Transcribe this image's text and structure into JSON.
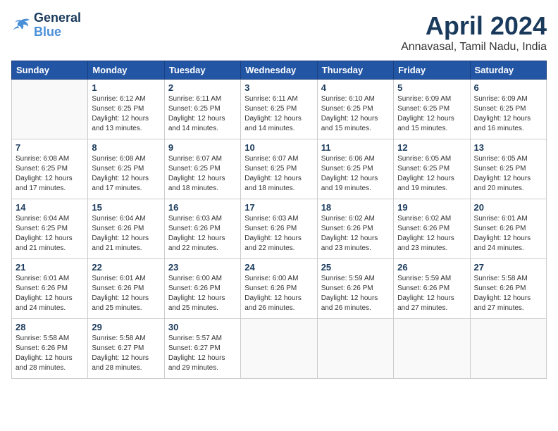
{
  "header": {
    "logo_line1": "General",
    "logo_line2": "Blue",
    "month_title": "April 2024",
    "subtitle": "Annavasal, Tamil Nadu, India"
  },
  "weekdays": [
    "Sunday",
    "Monday",
    "Tuesday",
    "Wednesday",
    "Thursday",
    "Friday",
    "Saturday"
  ],
  "weeks": [
    [
      {
        "day": null,
        "info": null
      },
      {
        "day": "1",
        "info": "Sunrise: 6:12 AM\nSunset: 6:25 PM\nDaylight: 12 hours\nand 13 minutes."
      },
      {
        "day": "2",
        "info": "Sunrise: 6:11 AM\nSunset: 6:25 PM\nDaylight: 12 hours\nand 14 minutes."
      },
      {
        "day": "3",
        "info": "Sunrise: 6:11 AM\nSunset: 6:25 PM\nDaylight: 12 hours\nand 14 minutes."
      },
      {
        "day": "4",
        "info": "Sunrise: 6:10 AM\nSunset: 6:25 PM\nDaylight: 12 hours\nand 15 minutes."
      },
      {
        "day": "5",
        "info": "Sunrise: 6:09 AM\nSunset: 6:25 PM\nDaylight: 12 hours\nand 15 minutes."
      },
      {
        "day": "6",
        "info": "Sunrise: 6:09 AM\nSunset: 6:25 PM\nDaylight: 12 hours\nand 16 minutes."
      }
    ],
    [
      {
        "day": "7",
        "info": "Sunrise: 6:08 AM\nSunset: 6:25 PM\nDaylight: 12 hours\nand 17 minutes."
      },
      {
        "day": "8",
        "info": "Sunrise: 6:08 AM\nSunset: 6:25 PM\nDaylight: 12 hours\nand 17 minutes."
      },
      {
        "day": "9",
        "info": "Sunrise: 6:07 AM\nSunset: 6:25 PM\nDaylight: 12 hours\nand 18 minutes."
      },
      {
        "day": "10",
        "info": "Sunrise: 6:07 AM\nSunset: 6:25 PM\nDaylight: 12 hours\nand 18 minutes."
      },
      {
        "day": "11",
        "info": "Sunrise: 6:06 AM\nSunset: 6:25 PM\nDaylight: 12 hours\nand 19 minutes."
      },
      {
        "day": "12",
        "info": "Sunrise: 6:05 AM\nSunset: 6:25 PM\nDaylight: 12 hours\nand 19 minutes."
      },
      {
        "day": "13",
        "info": "Sunrise: 6:05 AM\nSunset: 6:25 PM\nDaylight: 12 hours\nand 20 minutes."
      }
    ],
    [
      {
        "day": "14",
        "info": "Sunrise: 6:04 AM\nSunset: 6:25 PM\nDaylight: 12 hours\nand 21 minutes."
      },
      {
        "day": "15",
        "info": "Sunrise: 6:04 AM\nSunset: 6:26 PM\nDaylight: 12 hours\nand 21 minutes."
      },
      {
        "day": "16",
        "info": "Sunrise: 6:03 AM\nSunset: 6:26 PM\nDaylight: 12 hours\nand 22 minutes."
      },
      {
        "day": "17",
        "info": "Sunrise: 6:03 AM\nSunset: 6:26 PM\nDaylight: 12 hours\nand 22 minutes."
      },
      {
        "day": "18",
        "info": "Sunrise: 6:02 AM\nSunset: 6:26 PM\nDaylight: 12 hours\nand 23 minutes."
      },
      {
        "day": "19",
        "info": "Sunrise: 6:02 AM\nSunset: 6:26 PM\nDaylight: 12 hours\nand 23 minutes."
      },
      {
        "day": "20",
        "info": "Sunrise: 6:01 AM\nSunset: 6:26 PM\nDaylight: 12 hours\nand 24 minutes."
      }
    ],
    [
      {
        "day": "21",
        "info": "Sunrise: 6:01 AM\nSunset: 6:26 PM\nDaylight: 12 hours\nand 24 minutes."
      },
      {
        "day": "22",
        "info": "Sunrise: 6:01 AM\nSunset: 6:26 PM\nDaylight: 12 hours\nand 25 minutes."
      },
      {
        "day": "23",
        "info": "Sunrise: 6:00 AM\nSunset: 6:26 PM\nDaylight: 12 hours\nand 25 minutes."
      },
      {
        "day": "24",
        "info": "Sunrise: 6:00 AM\nSunset: 6:26 PM\nDaylight: 12 hours\nand 26 minutes."
      },
      {
        "day": "25",
        "info": "Sunrise: 5:59 AM\nSunset: 6:26 PM\nDaylight: 12 hours\nand 26 minutes."
      },
      {
        "day": "26",
        "info": "Sunrise: 5:59 AM\nSunset: 6:26 PM\nDaylight: 12 hours\nand 27 minutes."
      },
      {
        "day": "27",
        "info": "Sunrise: 5:58 AM\nSunset: 6:26 PM\nDaylight: 12 hours\nand 27 minutes."
      }
    ],
    [
      {
        "day": "28",
        "info": "Sunrise: 5:58 AM\nSunset: 6:26 PM\nDaylight: 12 hours\nand 28 minutes."
      },
      {
        "day": "29",
        "info": "Sunrise: 5:58 AM\nSunset: 6:27 PM\nDaylight: 12 hours\nand 28 minutes."
      },
      {
        "day": "30",
        "info": "Sunrise: 5:57 AM\nSunset: 6:27 PM\nDaylight: 12 hours\nand 29 minutes."
      },
      {
        "day": null,
        "info": null
      },
      {
        "day": null,
        "info": null
      },
      {
        "day": null,
        "info": null
      },
      {
        "day": null,
        "info": null
      }
    ]
  ]
}
